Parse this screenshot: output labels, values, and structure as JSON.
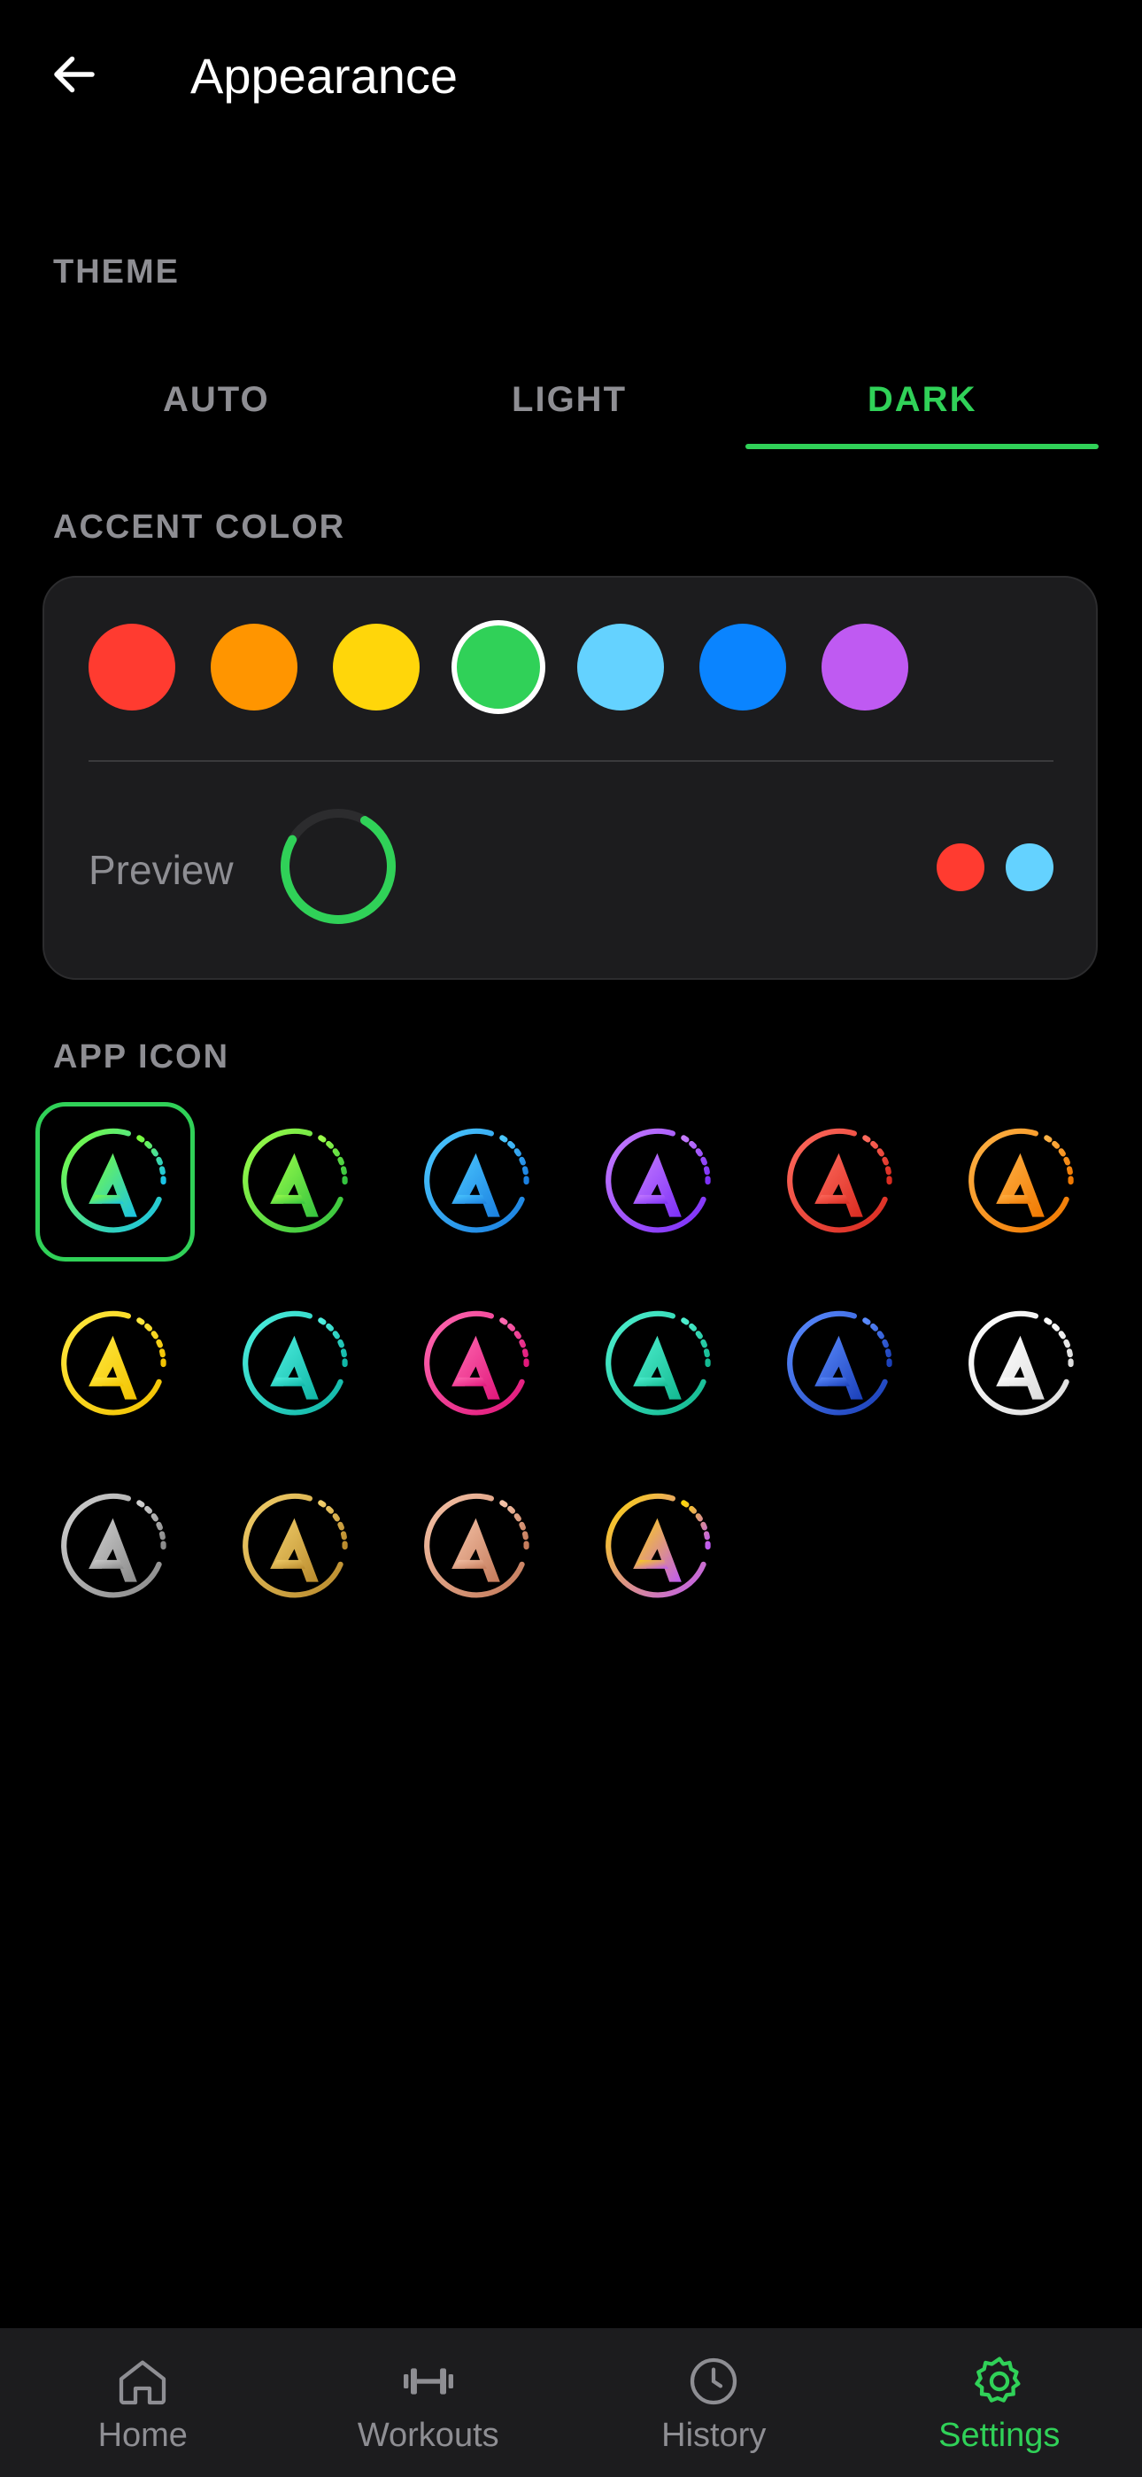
{
  "header": {
    "title": "Appearance"
  },
  "theme": {
    "section_label": "THEME",
    "tabs": [
      {
        "label": "AUTO",
        "active": false
      },
      {
        "label": "LIGHT",
        "active": false
      },
      {
        "label": "DARK",
        "active": true
      }
    ]
  },
  "accent": {
    "section_label": "ACCENT COLOR",
    "swatches": [
      "#ff3b30",
      "#ff9500",
      "#ffd60a",
      "#30d158",
      "#64d2ff",
      "#0a84ff",
      "#bf5af2"
    ],
    "selected_index": 3,
    "preview_label": "Preview",
    "preview_dots": [
      "#ff3b30",
      "#64d2ff"
    ]
  },
  "app_icon": {
    "section_label": "APP ICON",
    "selected_index": 0,
    "icons": [
      {
        "name": "gradient-green-blue",
        "colors": [
          "#7cff3a",
          "#19c2e8"
        ]
      },
      {
        "name": "green",
        "colors": [
          "#9dff4a",
          "#33c23f"
        ]
      },
      {
        "name": "blue",
        "colors": [
          "#4cc9ff",
          "#1a7fe0"
        ]
      },
      {
        "name": "purple",
        "colors": [
          "#c77dff",
          "#7b2ff7"
        ]
      },
      {
        "name": "red",
        "colors": [
          "#ff6b5e",
          "#d92b20"
        ]
      },
      {
        "name": "orange",
        "colors": [
          "#ffb347",
          "#f07800"
        ]
      },
      {
        "name": "yellow",
        "colors": [
          "#ffe940",
          "#f2c200"
        ]
      },
      {
        "name": "teal",
        "colors": [
          "#4ff0e0",
          "#0fb5a6"
        ]
      },
      {
        "name": "pink",
        "colors": [
          "#ff6ab1",
          "#e0167a"
        ]
      },
      {
        "name": "mint",
        "colors": [
          "#4ff0d0",
          "#12b890"
        ]
      },
      {
        "name": "navy",
        "colors": [
          "#5b8cff",
          "#1a3fb8"
        ]
      },
      {
        "name": "white",
        "colors": [
          "#ffffff",
          "#dddddd"
        ]
      },
      {
        "name": "silver",
        "colors": [
          "#d0d0d0",
          "#8a8a8a"
        ]
      },
      {
        "name": "gold",
        "colors": [
          "#f2cf6b",
          "#b98a2c"
        ]
      },
      {
        "name": "rose-gold",
        "colors": [
          "#f5c3a8",
          "#c47a5a"
        ]
      },
      {
        "name": "rainbow",
        "colors": [
          "#ffd60a",
          "#bf5af2"
        ]
      }
    ]
  },
  "nav": {
    "items": [
      {
        "label": "Home",
        "icon": "home-icon",
        "active": false
      },
      {
        "label": "Workouts",
        "icon": "dumbbell-icon",
        "active": false
      },
      {
        "label": "History",
        "icon": "clock-icon",
        "active": false
      },
      {
        "label": "Settings",
        "icon": "gear-icon",
        "active": true
      }
    ]
  },
  "colors": {
    "accent": "#30d158",
    "card": "#1c1c1e",
    "muted": "#8e8e93"
  }
}
